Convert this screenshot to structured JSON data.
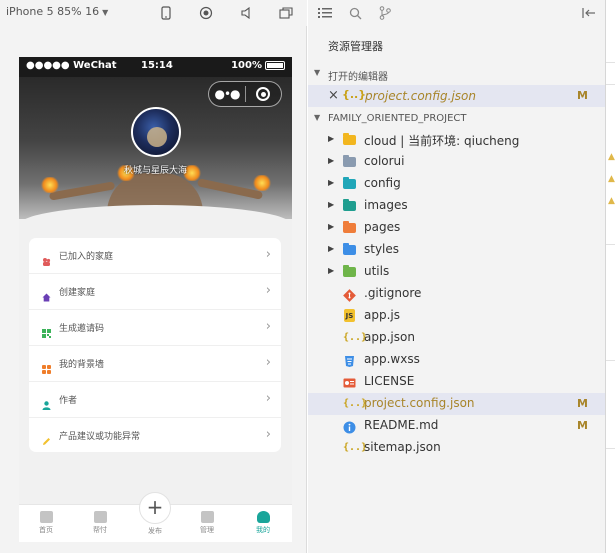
{
  "simulator": {
    "device_label": "iPhone 5 85% 16",
    "status_bar": {
      "carrier": "●●●●● WeChat",
      "time": "15:14",
      "battery": "100%"
    },
    "banner": {
      "username": "秋城与星辰大海"
    },
    "menu": [
      {
        "label": "已加入的家庭",
        "icon": "family-icon",
        "color": "#e05b5b"
      },
      {
        "label": "创建家庭",
        "icon": "home-icon",
        "color": "#6a3fb5"
      },
      {
        "label": "生成邀请码",
        "icon": "qrcode-icon",
        "color": "#3cb35a"
      },
      {
        "label": "我的背景墙",
        "icon": "grid-icon",
        "color": "#ef7d2a"
      },
      {
        "label": "作者",
        "icon": "user-icon",
        "color": "#19a59a"
      },
      {
        "label": "产品建议或功能异常",
        "icon": "pencil-icon",
        "color": "#f2c12e"
      }
    ],
    "tabs": [
      {
        "label": "首页",
        "icon": "home-tab-icon",
        "active": false
      },
      {
        "label": "帮忖",
        "icon": "help-tab-icon",
        "active": false
      },
      {
        "label": "发布",
        "icon": "plus-tab-icon",
        "active": false
      },
      {
        "label": "管理",
        "icon": "manage-tab-icon",
        "active": false
      },
      {
        "label": "我的",
        "icon": "me-tab-icon",
        "active": true
      }
    ],
    "accent": "#19a59a"
  },
  "explorer": {
    "title": "资源管理器",
    "open_editors_label": "打开的编辑器",
    "open_editor": {
      "name": "project.config.json",
      "status": "M"
    },
    "project_label": "FAMILY_ORIENTED_PROJECT",
    "tree": [
      {
        "name": "cloud | 当前环境: qiucheng",
        "type": "folder",
        "color": "#f2b61f",
        "expandable": true
      },
      {
        "name": "colorui",
        "type": "folder",
        "color": "#8a9bb0",
        "expandable": true
      },
      {
        "name": "config",
        "type": "folder",
        "color": "#20a6b8",
        "expandable": true
      },
      {
        "name": "images",
        "type": "folder",
        "color": "#1f9e8f",
        "expandable": true
      },
      {
        "name": "pages",
        "type": "folder",
        "color": "#ef7d3a",
        "expandable": true
      },
      {
        "name": "styles",
        "type": "folder",
        "color": "#3d8ee6",
        "expandable": true
      },
      {
        "name": "utils",
        "type": "folder",
        "color": "#6fb54a",
        "expandable": true
      },
      {
        "name": ".gitignore",
        "type": "file",
        "icon": "git-icon",
        "color": "#e45b38",
        "expandable": false
      },
      {
        "name": "app.js",
        "type": "file",
        "icon": "js-icon",
        "color": "#f2c12e",
        "expandable": false
      },
      {
        "name": "app.json",
        "type": "file",
        "icon": "json-icon",
        "color": "#c9a21a",
        "expandable": false
      },
      {
        "name": "app.wxss",
        "type": "file",
        "icon": "css-icon",
        "color": "#3d8ee6",
        "expandable": false
      },
      {
        "name": "LICENSE",
        "type": "file",
        "icon": "license-icon",
        "color": "#e45b38",
        "expandable": false
      },
      {
        "name": "project.config.json",
        "type": "file",
        "icon": "json-icon",
        "color": "#c9a21a",
        "expandable": false,
        "selected": true,
        "status": "M"
      },
      {
        "name": "README.md",
        "type": "file",
        "icon": "info-icon",
        "color": "#3d8ee6",
        "expandable": false,
        "status": "M"
      },
      {
        "name": "sitemap.json",
        "type": "file",
        "icon": "json-icon",
        "color": "#c9a21a",
        "expandable": false
      }
    ],
    "selected_color": "#e4e6f1",
    "modified_color": "#a8852a"
  }
}
